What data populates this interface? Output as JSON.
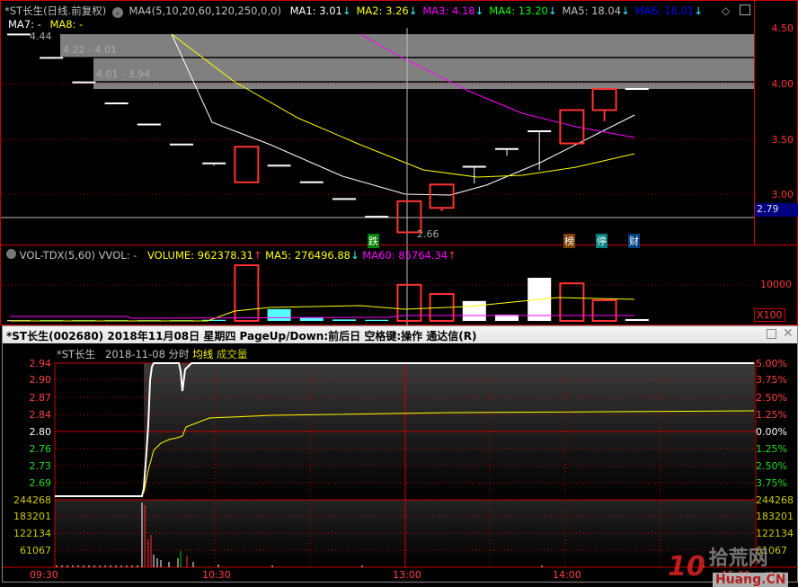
{
  "top_chart": {
    "title": "*ST长生(日线.前复权)",
    "indicator": "MA4(5,10,20,60,120,250,0,0)",
    "ma": [
      {
        "label": "MA1: 3.01",
        "color": "#ffffff"
      },
      {
        "label": "MA2: 3.26",
        "color": "#ffff00"
      },
      {
        "label": "MA3: 4.18",
        "color": "#ff00ff"
      },
      {
        "label": "MA4: 13.20",
        "color": "#00ff00"
      },
      {
        "label": "MA5: 18.04",
        "color": "#c0c0c0"
      },
      {
        "label": "MA6: 16.01",
        "color": "#0000ff"
      }
    ],
    "ma7": "MA7: -",
    "ma8": "MA8: -",
    "down_arrow": "↓",
    "price_axis": [
      "4.50",
      "4.00",
      "3.50",
      "3.00"
    ],
    "current_price": "2.79",
    "gap_labels": [
      "4.44",
      "4.22 - 4.01",
      "4.01 - 3.94"
    ],
    "low_label": "2.66",
    "tags": [
      {
        "text": "跌",
        "color": "#008000"
      },
      {
        "text": "榜",
        "color": "#804000"
      },
      {
        "text": "停",
        "color": "#008080"
      },
      {
        "text": "财",
        "color": "#004080"
      }
    ],
    "candles": [
      [
        4.44,
        4.44,
        4.44,
        4.44
      ],
      [
        4.23,
        4.23,
        4.23,
        4.23
      ],
      [
        4.01,
        4.01,
        4.01,
        4.01
      ],
      [
        3.82,
        3.82,
        3.82,
        3.82
      ],
      [
        3.63,
        3.63,
        3.63,
        3.63
      ],
      [
        3.45,
        3.45,
        3.45,
        3.45
      ],
      [
        3.27,
        3.28,
        3.26,
        3.27
      ],
      [
        3.11,
        3.43,
        3.11,
        3.43
      ],
      [
        3.26,
        3.26,
        3.26,
        3.26
      ],
      [
        3.11,
        3.11,
        3.11,
        3.11
      ],
      [
        2.96,
        2.96,
        2.96,
        2.96
      ],
      [
        2.8,
        2.8,
        2.8,
        2.81
      ],
      [
        2.66,
        2.94,
        2.66,
        2.94
      ],
      [
        2.88,
        3.09,
        2.85,
        3.09
      ],
      [
        3.25,
        3.25,
        3.1,
        3.25
      ],
      [
        3.41,
        3.41,
        3.35,
        3.41
      ],
      [
        3.57,
        3.57,
        3.22,
        3.57
      ],
      [
        3.46,
        3.76,
        3.46,
        3.76
      ],
      [
        3.76,
        3.95,
        3.66,
        3.95
      ],
      [
        3.95,
        3.95,
        3.95,
        3.95
      ]
    ],
    "volume_header": {
      "name": "VOL-TDX(5,60)",
      "vvol": "VVOL: -",
      "volume": "VOLUME: 962378.31",
      "ma5": "MA5: 276496.88",
      "ma60": "MA60: 85764.34",
      "up": "↑",
      "down": "↓"
    },
    "volume_axis": "10000",
    "volume_unit": "X100",
    "volumes": [
      200,
      200,
      200,
      200,
      200,
      200,
      300,
      15100,
      3200,
      1000,
      400,
      300,
      9800,
      7300,
      5400,
      1700,
      11700,
      10200,
      5600,
      500
    ]
  },
  "popup": {
    "title": "*ST长生(002680) 2018年11月08日 星期四 PageUp/Down:前后日 空格键:操作 通达信(R)",
    "sub_name": "*ST长生",
    "sub_date": "2018-11-08 分时",
    "avg_label": "均线",
    "vol_label": "成交量",
    "price_labels": [
      "2.94",
      "2.90",
      "2.87",
      "2.84",
      "2.80",
      "2.76",
      "2.73",
      "2.69"
    ],
    "pct_labels": [
      "5.00%",
      "3.75%",
      "2.50%",
      "1.25%",
      "0.00%",
      "1.25%",
      "2.50%",
      "3.75%"
    ],
    "vol_labels": [
      "244268",
      "183201",
      "122134",
      "61067"
    ],
    "times": [
      "09:30",
      "10:30",
      "13:00",
      "14:00",
      "15:00"
    ],
    "op_label": "操作"
  },
  "watermark": {
    "num": "10",
    "cn": "拾荒网",
    "en": "Huang.CN"
  }
}
